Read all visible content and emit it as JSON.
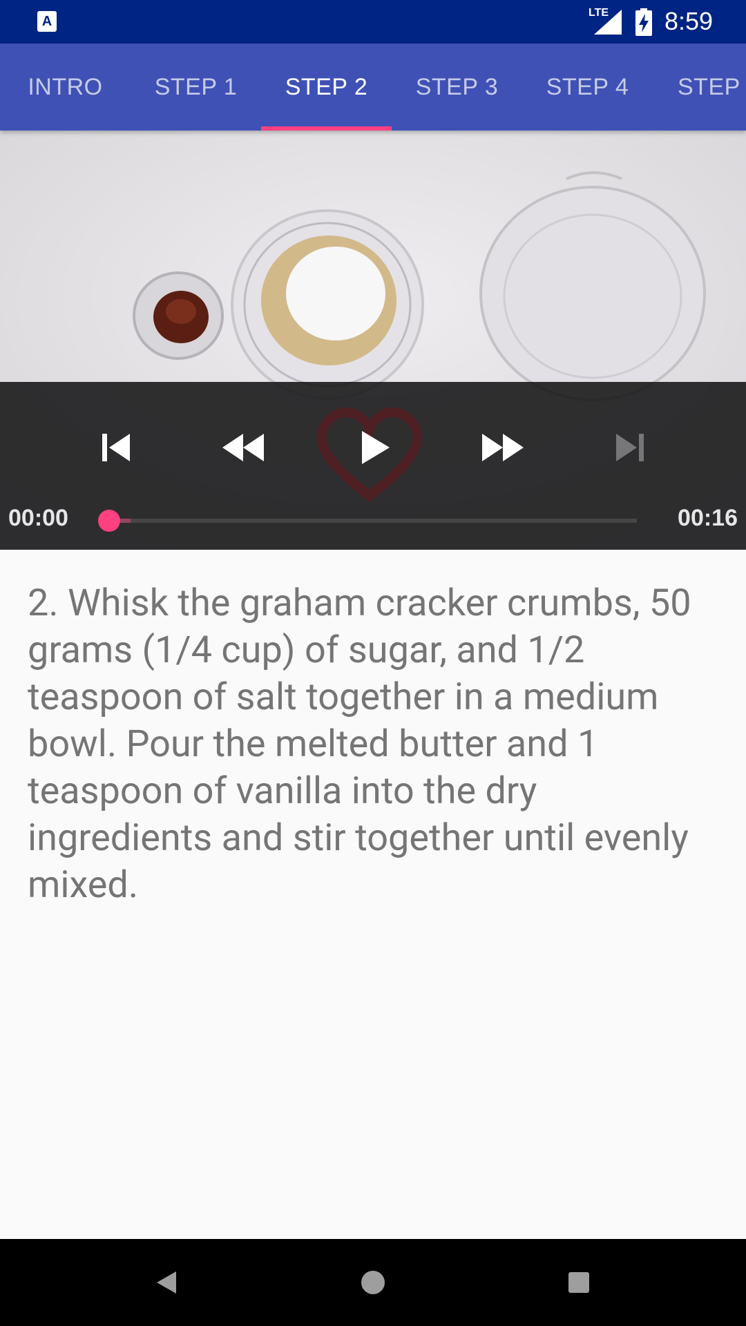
{
  "status_bar": {
    "app_icon_letter": "A",
    "network": "LTE",
    "time": "8:59"
  },
  "tabs": [
    {
      "label": "INTRO"
    },
    {
      "label": "STEP 1"
    },
    {
      "label": "STEP 2",
      "active": true
    },
    {
      "label": "STEP 3"
    },
    {
      "label": "STEP 4"
    },
    {
      "label": "STEP"
    }
  ],
  "player": {
    "current_time": "00:00",
    "duration": "00:16",
    "progress": 0.0,
    "buffered": 0.04
  },
  "step": {
    "description": "2. Whisk the graham cracker crumbs, 50 grams (1/4 cup) of sugar, and 1/2 teaspoon of salt together in a medium bowl. Pour the melted butter and 1 teaspoon of vanilla into the dry ingredients and stir together until evenly mixed."
  },
  "colors": {
    "status_bar": "#002484",
    "primary": "#3f51b5",
    "accent": "#ff4081"
  },
  "icons": {
    "prev": "skip-previous-icon",
    "rewind": "rewind-icon",
    "play": "play-icon",
    "fast_forward": "fast-forward-icon",
    "next": "skip-next-icon"
  }
}
